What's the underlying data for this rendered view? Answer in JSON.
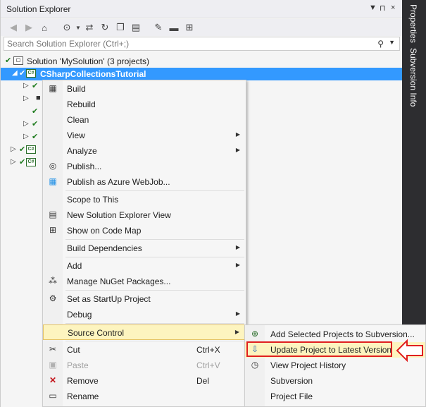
{
  "solution_explorer": {
    "title": "Solution Explorer",
    "title_controls": [
      "▼",
      "⊓",
      "×"
    ],
    "search_placeholder": "Search Solution Explorer (Ctrl+;)",
    "tree": [
      {
        "label": "Solution 'MySolution' (3 projects)",
        "level": 0,
        "selected": false
      },
      {
        "label": "CSharpCollectionsTutorial",
        "level": 1,
        "selected": true
      },
      {
        "label": "",
        "level": 2
      },
      {
        "label": "",
        "level": 2
      },
      {
        "label": "",
        "level": 2
      },
      {
        "label": "",
        "level": 2
      },
      {
        "label": "",
        "level": 2
      },
      {
        "label": "",
        "level": 1
      },
      {
        "label": "",
        "level": 1
      }
    ]
  },
  "sidebar": {
    "tabs": [
      "Properties",
      "Subversion Info"
    ]
  },
  "context_menu": {
    "items": [
      {
        "label": "Build",
        "icon": "build-icon"
      },
      {
        "label": "Rebuild"
      },
      {
        "label": "Clean"
      },
      {
        "label": "View",
        "submenu": true
      },
      {
        "label": "Analyze",
        "submenu": true
      },
      {
        "label": "Publish...",
        "icon": "publish-icon"
      },
      {
        "label": "Publish as Azure WebJob...",
        "icon": "windows-icon"
      },
      {
        "label": "Scope to This"
      },
      {
        "label": "New Solution Explorer View",
        "icon": "new-view-icon"
      },
      {
        "label": "Show on Code Map",
        "icon": "code-map-icon"
      },
      {
        "label": "Build Dependencies",
        "submenu": true
      },
      {
        "label": "Add",
        "submenu": true
      },
      {
        "label": "Manage NuGet Packages...",
        "icon": "nuget-icon"
      },
      {
        "label": "Set as StartUp Project",
        "icon": "gear-icon"
      },
      {
        "label": "Debug",
        "submenu": true
      },
      {
        "label": "Source Control",
        "submenu": true,
        "highlighted": true
      },
      {
        "label": "Cut",
        "shortcut": "Ctrl+X",
        "icon": "scissors-icon"
      },
      {
        "label": "Paste",
        "shortcut": "Ctrl+V",
        "icon": "paste-icon",
        "disabled": true
      },
      {
        "label": "Remove",
        "shortcut": "Del",
        "icon": "remove-icon"
      },
      {
        "label": "Rename",
        "icon": "rename-icon"
      }
    ]
  },
  "source_control_submenu": {
    "items": [
      {
        "label": "Add Selected Projects to Subversion...",
        "icon": "add-to-svn-icon"
      },
      {
        "label": "Update Project to Latest Version",
        "icon": "update-icon",
        "emphasized": true
      },
      {
        "label": "View Project History",
        "icon": "history-icon"
      },
      {
        "label": "Subversion"
      },
      {
        "label": "Project File"
      }
    ]
  },
  "colors": {
    "selection": "#3399ff",
    "highlight": "#fdf4bf",
    "annotation_red": "#e02020",
    "sidebar_bg": "#2d2d30"
  }
}
